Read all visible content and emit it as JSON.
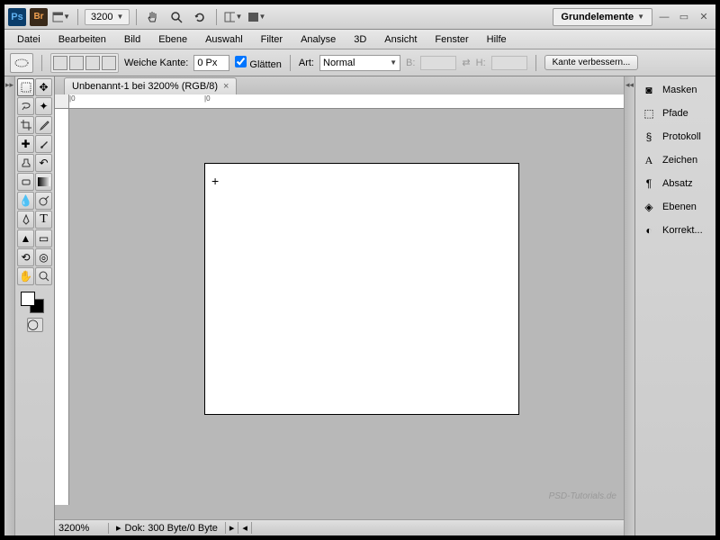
{
  "topbar": {
    "zoom": "3200",
    "workspace": "Grundelemente"
  },
  "menu": [
    "Datei",
    "Bearbeiten",
    "Bild",
    "Ebene",
    "Auswahl",
    "Filter",
    "Analyse",
    "3D",
    "Ansicht",
    "Fenster",
    "Hilfe"
  ],
  "options": {
    "feather_label": "Weiche Kante:",
    "feather_value": "0 Px",
    "antialias_label": "Glätten",
    "style_label": "Art:",
    "style_value": "Normal",
    "w_label": "B:",
    "h_label": "H:",
    "refine": "Kante verbessern..."
  },
  "doc": {
    "tab_title": "Unbenannt-1 bei 3200% (RGB/8)"
  },
  "status": {
    "zoom": "3200%",
    "doc_info": "Dok: 300 Byte/0 Byte"
  },
  "panels": [
    {
      "label": "Masken"
    },
    {
      "label": "Pfade"
    },
    {
      "label": "Protokoll"
    },
    {
      "label": "Zeichen"
    },
    {
      "label": "Absatz"
    },
    {
      "label": "Ebenen"
    },
    {
      "label": "Korrekt..."
    }
  ],
  "watermark": "PSD-Tutorials.de"
}
